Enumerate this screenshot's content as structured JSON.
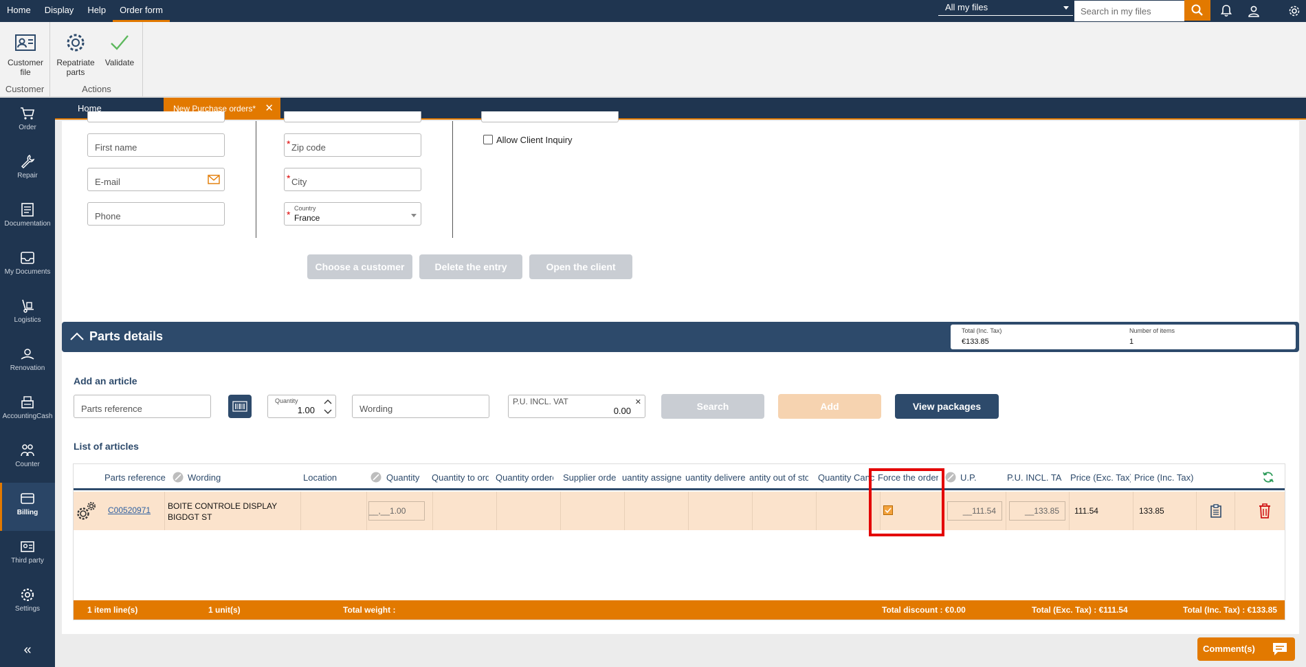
{
  "menu": [
    "Home",
    "Display",
    "Help",
    "Order form"
  ],
  "files_select": "All my files",
  "search": {
    "placeholder": "Search in my files"
  },
  "ribbon": {
    "customer_group": "Customer",
    "customer_file": "Customer file",
    "actions_group": "Actions",
    "repatriate": "Repatriate parts",
    "validate": "Validate"
  },
  "tabs": {
    "home": "Home",
    "active": "New Purchase orders*"
  },
  "sidebar": [
    "Order",
    "Repair",
    "Documentation",
    "My Documents",
    "Logistics",
    "Renovation",
    "AccountingCash",
    "Counter",
    "Billing",
    "Third party",
    "Settings"
  ],
  "form": {
    "first_name": "First name",
    "email": "E-mail",
    "phone": "Phone",
    "zip": "Zip code",
    "city": "City",
    "country_label": "Country",
    "country_value": "France",
    "allow_inquiry": "Allow Client Inquiry"
  },
  "buttons": {
    "choose_customer": "Choose a customer",
    "delete_entry": "Delete the entry",
    "open_client": "Open the client"
  },
  "parts": {
    "title": "Parts details",
    "total_label": "Total (Inc. Tax)",
    "total_value": "€133.85",
    "items_label": "Number of items",
    "items_value": "1"
  },
  "add_article": {
    "title": "Add an article",
    "parts_ref": "Parts reference",
    "qty_label": "Quantity",
    "qty_value": "1.00",
    "wording": "Wording",
    "pu_label": "P.U. INCL. VAT",
    "pu_value": "0.00",
    "search": "Search",
    "add": "Add",
    "view_packages": "View packages"
  },
  "list": {
    "title": "List of articles",
    "headers": [
      "Parts reference",
      "Wording",
      "Location",
      "Quantity",
      "Quantity to ord",
      "Quantity ordere",
      "Supplier orde",
      "uantity assigne",
      "uantity delivere",
      "antity out of sto",
      "Quantity Canc",
      "Force the order",
      "U.P.",
      "P.U. INCL. TAX",
      "Price (Exc. Tax)",
      "Price (Inc. Tax)"
    ],
    "row": {
      "ref": "C00520971",
      "wording": "BOITE CONTROLE DISPLAY BIGDGT ST",
      "qty": "__,__1.00",
      "up": "__111.54",
      "pu_incl": "__133.85",
      "price_exc": "111.54",
      "price_inc": "133.85"
    },
    "footer": {
      "lines": "1 item line(s)",
      "units": "1 unit(s)",
      "weight": "Total weight :",
      "discount": "Total discount : €0.00",
      "exc": "Total (Exc. Tax) : €111.54",
      "inc": "Total (Inc. Tax) : €133.85"
    }
  },
  "comment": "Comment(s)",
  "colors": {
    "navy": "#1f3550",
    "orange": "#e27900",
    "row": "#fbe3cc",
    "highlight": "#e30000"
  }
}
